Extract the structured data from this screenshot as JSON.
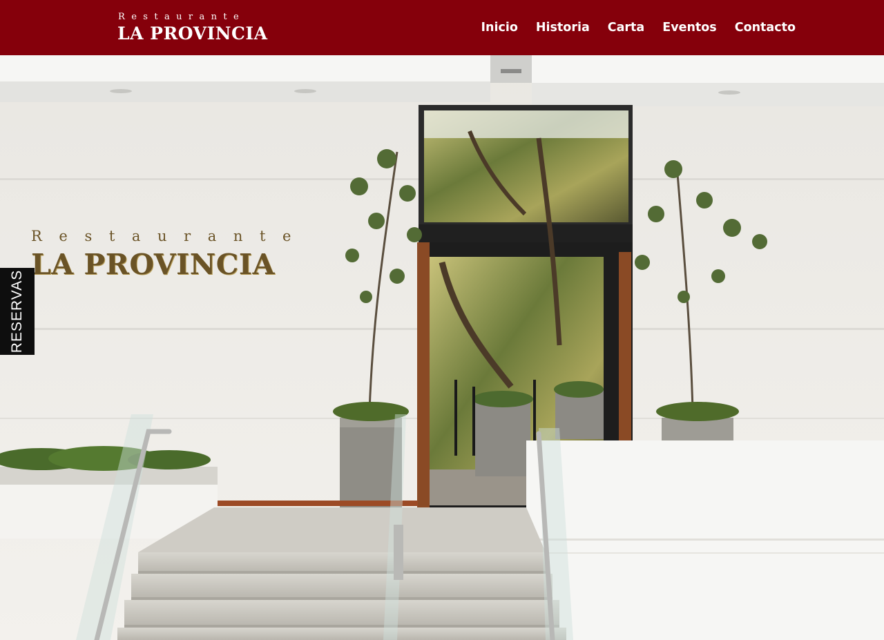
{
  "brand": {
    "small": "Restaurante",
    "big": "LA PROVINCIA"
  },
  "nav": {
    "items": [
      "Inicio",
      "Historia",
      "Carta",
      "Eventos",
      "Contacto"
    ]
  },
  "hero": {
    "sign_small": "Restaurante",
    "sign_big": "LA PROVINCIA"
  },
  "reservas": {
    "label": "RESERVAS"
  },
  "colors": {
    "header_bg": "#85000b",
    "reservas_bg": "#0e0e0e",
    "sign_gold": "#6a5326"
  }
}
